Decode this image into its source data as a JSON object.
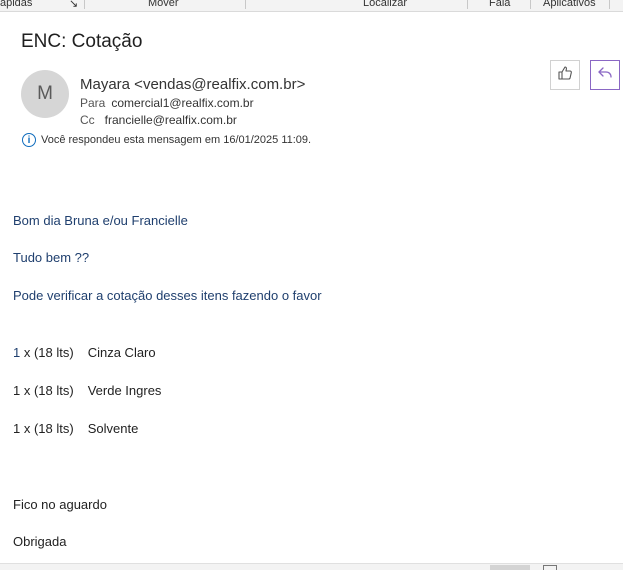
{
  "ribbon": {
    "groups": [
      "ápidas",
      "Mover",
      "Localizar",
      "Fala",
      "Aplicativos"
    ]
  },
  "message": {
    "subject": "ENC: Cotação",
    "avatar_initial": "M",
    "sender": "Mayara <vendas@realfix.com.br>",
    "to_label": "Para",
    "to": "comercial1@realfix.com.br",
    "cc_label": "Cc",
    "cc": "francielle@realfix.com.br",
    "info": "Você respondeu esta mensagem em 16/01/2025 11:09."
  },
  "actions": {
    "like_icon": "thumbs-up-icon",
    "reply_icon": "reply-icon",
    "accent": "#8a67c4"
  },
  "body": {
    "greeting": "Bom dia Bruna e/ou Francielle",
    "line2": "Tudo bem ??",
    "line3": "Pode verificar a cotação desses itens fazendo o favor",
    "items": [
      {
        "qty": "1",
        "rest": " x (18 lts)",
        "name": "Cinza Claro"
      },
      {
        "qty": "1",
        "rest": " x (18 lts)",
        "name": "Verde Ingres"
      },
      {
        "qty": "1",
        "rest": " x (18 lts)",
        "name": "Solvente"
      }
    ],
    "closing1": "Fico no aguardo",
    "closing2": "Obrigada"
  }
}
